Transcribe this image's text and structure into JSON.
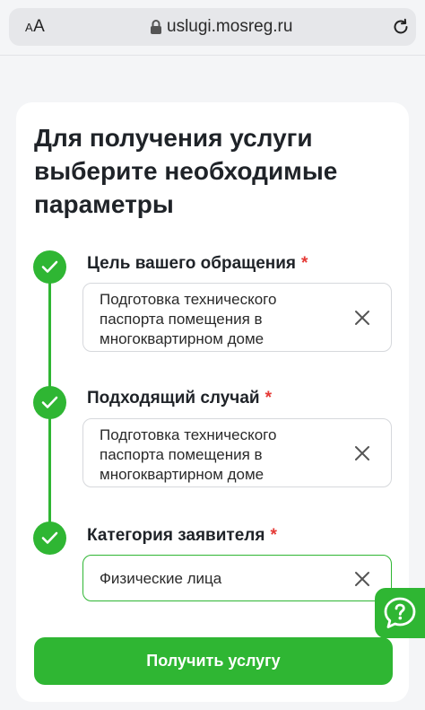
{
  "browser": {
    "aa_small": "A",
    "aa_large": "A",
    "url": "uslugi.mosreg.ru",
    "icons": [
      "lock-icon",
      "reload-icon"
    ]
  },
  "form": {
    "title": "Для получения услуги выберите необходимые параметры",
    "required_mark": "*",
    "fields": [
      {
        "label": "Цель вашего обращения",
        "value": "Подготовка технического паспорта помещения в многоквартирном доме",
        "completed": true,
        "focused": false
      },
      {
        "label": "Подходящий случай",
        "value": "Подготовка технического паспорта помещения в многоквартирном доме",
        "completed": true,
        "focused": false
      },
      {
        "label": "Категория заявителя",
        "value": "Физические лица",
        "completed": true,
        "focused": true
      }
    ],
    "submit_label": "Получить услугу"
  },
  "colors": {
    "accent": "#2fb633",
    "required": "#e53935",
    "background": "#f4f5f7",
    "card": "#ffffff"
  },
  "chat": {
    "icon": "chat-question-icon"
  }
}
